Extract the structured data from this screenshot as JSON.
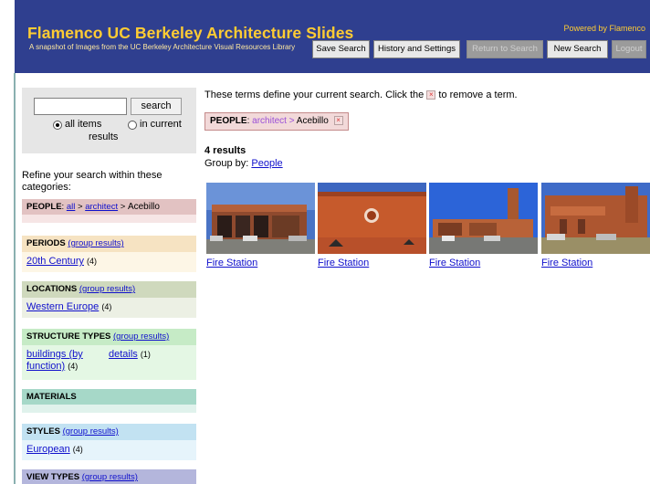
{
  "header": {
    "title": "Flamenco UC Berkeley Architecture Slides",
    "subtitle": "A snapshot of Images from the UC Berkeley Architecture Visual Resources Library",
    "powered_by": "Powered by Flamenco",
    "buttons": {
      "save_search": "Save Search",
      "history_settings": "History and Settings",
      "return_to_search": "Return to Search",
      "new_search": "New Search",
      "logout": "Logout"
    }
  },
  "search": {
    "input_value": "",
    "button": "search",
    "scope_all": "all items",
    "scope_current_line1": "in current",
    "scope_current_line2": "results",
    "selected_scope": "all items"
  },
  "sidebar": {
    "refine_text": "Refine your search within these categories:",
    "people": {
      "label": "PEOPLE",
      "separator": ":",
      "crumb_all": "all",
      "crumb_arrow1": ">",
      "crumb_architect": "architect",
      "crumb_arrow2": ">",
      "crumb_current": "Acebillo"
    },
    "periods": {
      "label": "PERIODS",
      "group_link": "(group results)",
      "items": [
        {
          "label": "20th Century",
          "count": "(4)"
        }
      ]
    },
    "locations": {
      "label": "LOCATIONS",
      "group_link": "(group results)",
      "items": [
        {
          "label": "Western Europe",
          "count": "(4)"
        }
      ]
    },
    "structure_types": {
      "label": "STRUCTURE TYPES",
      "group_link": "(group results)",
      "items": [
        {
          "label_line1": "buildings (by",
          "label_line2": "function)",
          "count": "(4)"
        },
        {
          "label": "details",
          "count": "(1)"
        }
      ]
    },
    "materials": {
      "label": "MATERIALS"
    },
    "styles": {
      "label": "STYLES",
      "group_link": "(group results)",
      "items": [
        {
          "label": "European",
          "count": "(4)"
        }
      ]
    },
    "view_types": {
      "label": "VIEW TYPES",
      "group_link": "(group results)"
    }
  },
  "main": {
    "instruction_before": "These terms define your current search. Click the",
    "instruction_after": "to remove a term.",
    "term": {
      "facet": "PEOPLE",
      "separator": ":",
      "parent": "architect",
      "arrow": ">",
      "value": "Acebillo",
      "remove": "×"
    },
    "results_count": "4 results",
    "group_by_label": "Group by:",
    "group_by_value": "People",
    "results": [
      {
        "caption": "Fire Station"
      },
      {
        "caption": "Fire Station"
      },
      {
        "caption": "Fire Station"
      },
      {
        "caption": "Fire Station"
      }
    ]
  },
  "colors": {
    "header_bg": "#2f3f8f",
    "title": "#ffcc33",
    "people_bg": "#e2c2c2",
    "periods_bg": "#f6e3c2",
    "locations_bg": "#cfd9bd",
    "structure_bg": "#c6ebc6",
    "materials_bg": "#a6d8c8",
    "styles_bg": "#c2e2f2",
    "view_types_bg": "#b4b6dc",
    "link": "#1010cc"
  }
}
